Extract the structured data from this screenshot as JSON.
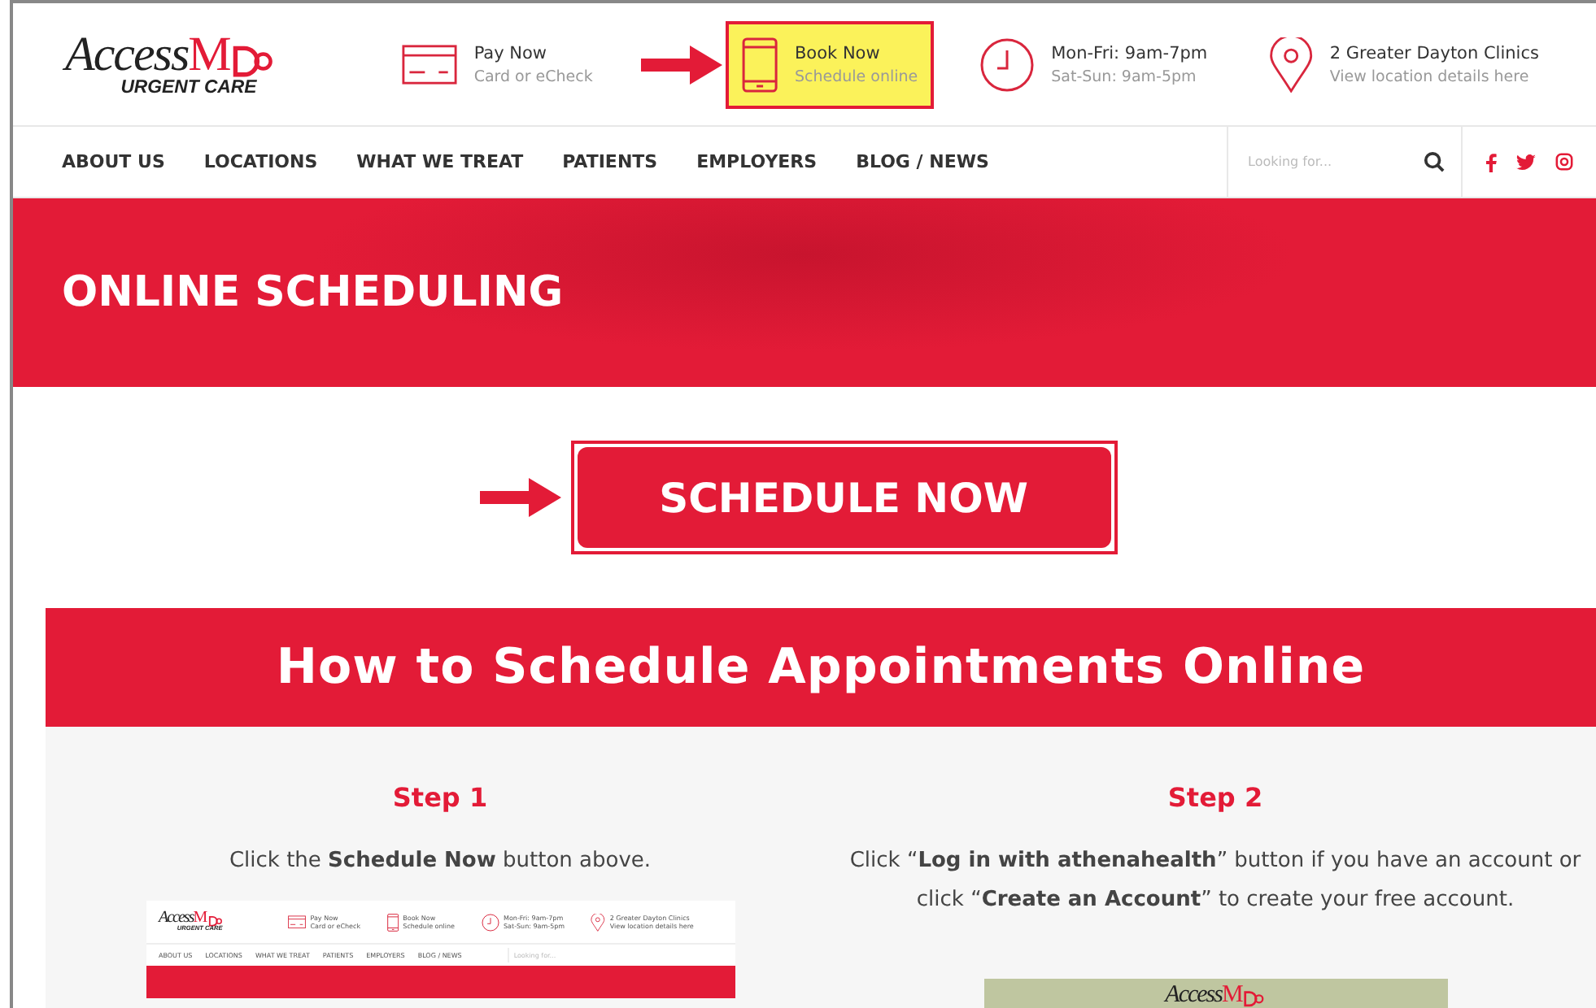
{
  "logo": {
    "word": "Access",
    "letter": "M",
    "tagline": "URGENT CARE"
  },
  "header_items": [
    {
      "kind": "card",
      "title": "Pay Now",
      "subtitle": "Card or eCheck",
      "highlighted": false,
      "arrow": false
    },
    {
      "kind": "phone",
      "title": "Book Now",
      "subtitle": "Schedule online",
      "highlighted": true,
      "arrow": true
    },
    {
      "kind": "clock",
      "title": "Mon-Fri: 9am-7pm",
      "subtitle": "Sat-Sun: 9am-5pm",
      "highlighted": false,
      "arrow": false
    },
    {
      "kind": "pin",
      "title": "2 Greater Dayton Clinics",
      "subtitle": "View location details here",
      "highlighted": false,
      "arrow": false
    }
  ],
  "nav": [
    "ABOUT US",
    "LOCATIONS",
    "WHAT WE TREAT",
    "PATIENTS",
    "EMPLOYERS",
    "BLOG / NEWS"
  ],
  "search": {
    "placeholder": "Looking for..."
  },
  "banner": {
    "title": "ONLINE SCHEDULING"
  },
  "schedule_button": {
    "label": "SCHEDULE NOW",
    "highlighted": true,
    "arrow": true
  },
  "section": {
    "title": "How to Schedule Appointments Online",
    "steps": [
      {
        "title": "Step 1",
        "text": "Click the **Schedule Now** button above."
      },
      {
        "title": "Step 2",
        "text": "Click “**Log in with athenahealth**” button if you have an account or click “**Create an Account**” to create your free account."
      }
    ]
  },
  "step1_screenshot": {
    "logo": {
      "word": "Access",
      "letter": "M",
      "tagline": "URGENT CARE"
    },
    "header_items": [
      {
        "kind": "card",
        "title": "Pay Now",
        "subtitle": "Card or eCheck"
      },
      {
        "kind": "phone",
        "title": "Book Now",
        "subtitle": "Schedule online"
      },
      {
        "kind": "clock",
        "title": "Mon-Fri: 9am-7pm",
        "subtitle": "Sat-Sun: 9am-5pm"
      },
      {
        "kind": "pin",
        "title": "2 Greater Dayton Clinics",
        "subtitle": "View location details here"
      }
    ],
    "nav": [
      "ABOUT US",
      "LOCATIONS",
      "WHAT WE TREAT",
      "PATIENTS",
      "EMPLOYERS",
      "BLOG / NEWS"
    ],
    "search": {
      "placeholder": "Looking for..."
    }
  },
  "step2_image": {
    "logo": {
      "word": "Access",
      "letter": "M"
    }
  }
}
